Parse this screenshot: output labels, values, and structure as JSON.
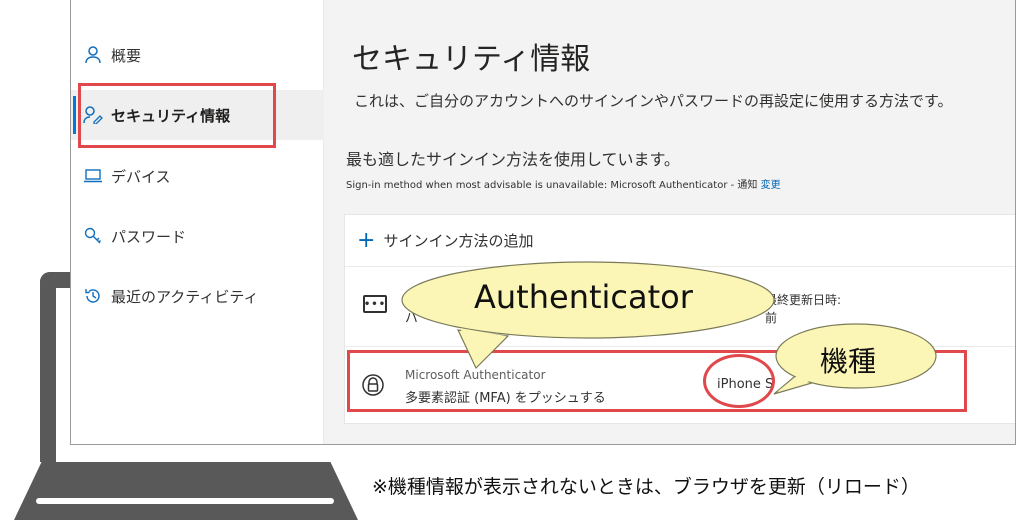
{
  "sidebar": {
    "items": [
      {
        "label": "概要",
        "icon": "person-icon"
      },
      {
        "label": "セキュリティ情報",
        "icon": "security-info-icon",
        "active": true
      },
      {
        "label": "デバイス",
        "icon": "laptop-icon"
      },
      {
        "label": "パスワード",
        "icon": "key-icon"
      },
      {
        "label": "最近のアクティビティ",
        "icon": "history-icon"
      }
    ]
  },
  "main": {
    "title": "セキュリティ情報",
    "description": "これは、ご自分のアカウントへのサインインやパスワードの再設定に使用する方法です。",
    "default_method": "最も適したサインイン方法を使用しています。",
    "default_sub": "Sign-in method when most advisable is unavailable: Microsoft Authenticator - 通知",
    "change_link": "変更",
    "add_method": "サインイン方法の追加",
    "password_row": {
      "fragment": "パ",
      "date_label": "最終更新日時:",
      "date_value": "前"
    },
    "authenticator_row": {
      "name": "Microsoft Authenticator",
      "description": "多要素認証 (MFA) をプッシュする",
      "device": "iPhone S"
    }
  },
  "callouts": {
    "authenticator": "Authenticator",
    "device_model": "機種"
  },
  "note": "※機種情報が表示されないときは、ブラウザを更新（リロード）",
  "colors": {
    "accent": "#0078d4",
    "highlight_red": "#e0484c",
    "callout_fill": "#fbf6b6"
  }
}
